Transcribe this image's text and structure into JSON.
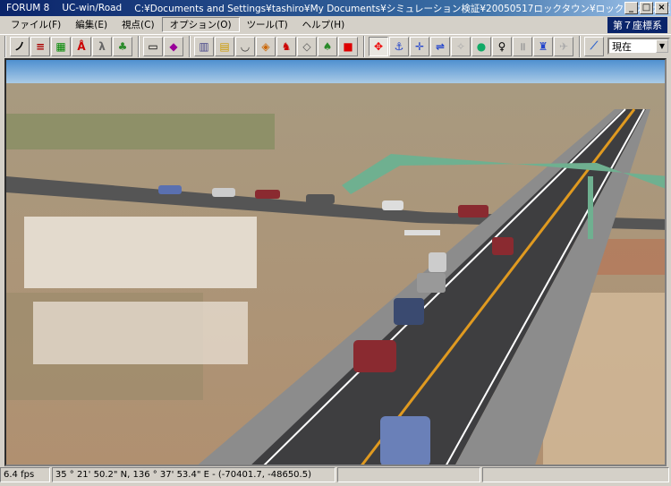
{
  "title": {
    "app": "FORUM 8",
    "product": "UC-win/Road",
    "path": "C:¥Documents and Settings¥tashiro¥My Documents¥シミュレーション検証¥20050517ロックタウン¥ロックタウン大垣交通シミュ..."
  },
  "menu": [
    {
      "label": "ファイル(F)"
    },
    {
      "label": "編集(E)"
    },
    {
      "label": "視点(C)"
    },
    {
      "label": "オプション(O)"
    },
    {
      "label": "ツール(T)"
    },
    {
      "label": "ヘルプ(H)"
    }
  ],
  "coordinate_system": "第７座標系",
  "toolbar": {
    "view_select": "現在"
  },
  "status": {
    "fps": "6.4 fps",
    "position": "35 °  21' 50.2\" N, 136 °  37' 53.4\" E  -  (-70401.7, -48650.5)"
  },
  "colors": {
    "title_bar": "#0a246a",
    "face": "#d4d0c8"
  }
}
